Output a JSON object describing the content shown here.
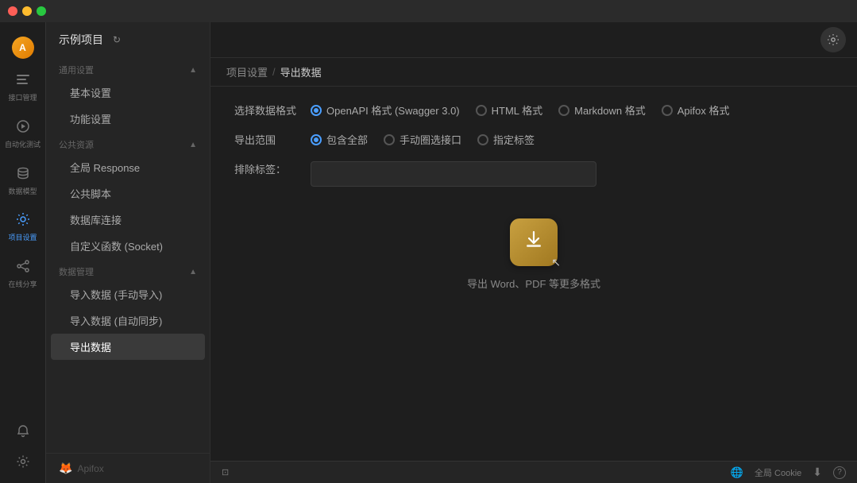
{
  "titlebar": {
    "btn_red": "close",
    "btn_yellow": "minimize",
    "btn_green": "maximize"
  },
  "sidebar": {
    "project_name": "示例项目",
    "project_icon": "↻",
    "avatar_initials": "A",
    "nav_icons": [
      {
        "id": "interface",
        "label": "接口管理",
        "symbol": "⊞"
      },
      {
        "id": "autotest",
        "label": "自动化测试",
        "symbol": "▷"
      },
      {
        "id": "datamodel",
        "label": "数据模型",
        "symbol": "⬡"
      },
      {
        "id": "settings",
        "label": "项目设置",
        "symbol": "⚙",
        "active": true
      },
      {
        "id": "share",
        "label": "在线分享",
        "symbol": "⇧"
      }
    ],
    "bottom_icons": [
      {
        "id": "bell",
        "symbol": "🔔"
      },
      {
        "id": "gear",
        "symbol": "⚙"
      }
    ],
    "sections": [
      {
        "label": "通用设置",
        "collapsible": true,
        "items": [
          {
            "id": "basic",
            "label": "基本设置"
          },
          {
            "id": "feature",
            "label": "功能设置"
          }
        ]
      },
      {
        "label": "公共资源",
        "collapsible": true,
        "items": [
          {
            "id": "global-response",
            "label": "全局 Response"
          },
          {
            "id": "public-script",
            "label": "公共脚本"
          },
          {
            "id": "db-connect",
            "label": "数据库连接"
          },
          {
            "id": "custom-func",
            "label": "自定义函数 (Socket)"
          }
        ]
      },
      {
        "label": "数据管理",
        "collapsible": true,
        "items": [
          {
            "id": "import-manual",
            "label": "导入数据 (手动导入)"
          },
          {
            "id": "import-auto",
            "label": "导入数据 (自动同步)"
          },
          {
            "id": "export",
            "label": "导出数据",
            "active": true
          }
        ]
      }
    ],
    "apifox_label": "Apifox"
  },
  "breadcrumb": {
    "items": [
      "项目设置",
      "导出数据"
    ],
    "separator": "/"
  },
  "form": {
    "format_label": "选择数据格式",
    "formats": [
      {
        "id": "openapi",
        "label": "OpenAPI 格式 (Swagger 3.0)",
        "selected": true
      },
      {
        "id": "html",
        "label": "HTML 格式",
        "selected": false
      },
      {
        "id": "markdown",
        "label": "Markdown 格式",
        "selected": false
      },
      {
        "id": "apifox",
        "label": "Apifox 格式",
        "selected": false
      }
    ],
    "range_label": "导出范围",
    "ranges": [
      {
        "id": "all",
        "label": "包含全部",
        "selected": true
      },
      {
        "id": "manual",
        "label": "手动圈选接口",
        "selected": false
      },
      {
        "id": "tag",
        "label": "指定标签",
        "selected": false
      }
    ],
    "exclude_label": "排除标签：",
    "tag_input_placeholder": "",
    "export_btn_label": "导出",
    "export_hint": "导出 Word、PDF 等更多格式"
  },
  "statusbar": {
    "left_icon": "⊡",
    "cookie_label": "全局 Cookie",
    "download_icon": "⬇",
    "help_icon": "?"
  },
  "top_right": {
    "settings_icon": "⚙"
  }
}
